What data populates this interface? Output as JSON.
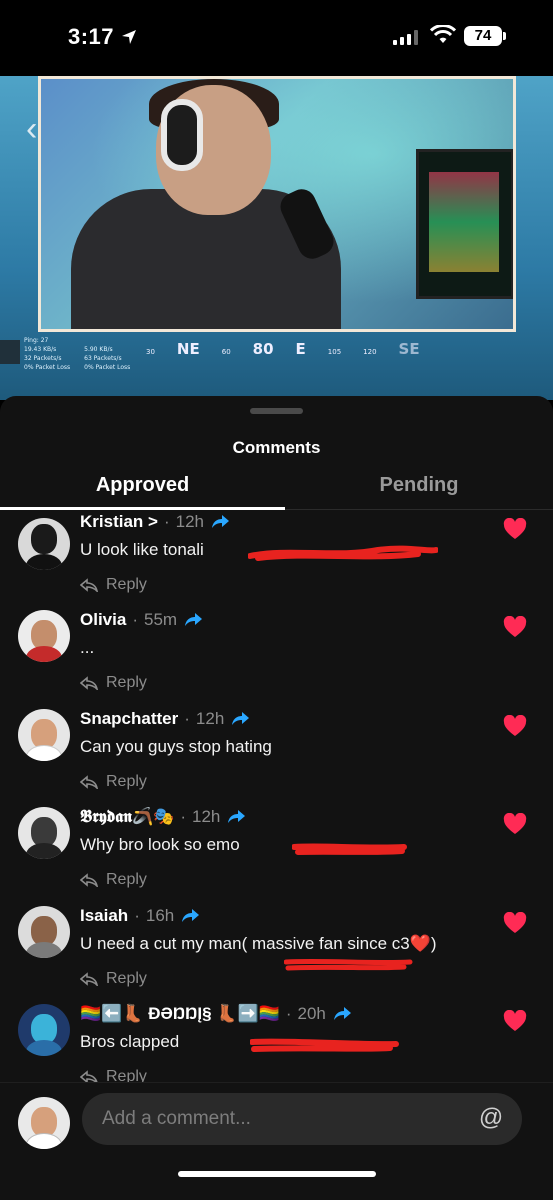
{
  "status_bar": {
    "time": "3:17",
    "battery": "74"
  },
  "video": {
    "hud_stats": [
      "Ping: 27",
      "19.43 KB/s",
      "32 Packets/s",
      "0% Packet Loss",
      "5.90 KB/s",
      "63 Packets/s",
      "0% Packet Loss"
    ],
    "compass": [
      "30",
      "NE",
      "60",
      "80",
      "E",
      "105",
      "120",
      "SE"
    ]
  },
  "sheet": {
    "title": "Comments",
    "tabs": [
      {
        "label": "Approved",
        "active": true
      },
      {
        "label": "Pending",
        "active": false
      }
    ]
  },
  "comments": [
    {
      "name": "Kristian >",
      "time": "12h",
      "text": "U look like tonali",
      "reply": "Reply",
      "liked": true
    },
    {
      "name": "Olivia",
      "time": "55m",
      "text": "...",
      "reply": "Reply",
      "liked": true
    },
    {
      "name": "Snapchatter",
      "time": "12h",
      "text": "Can you guys stop hating",
      "reply": "Reply",
      "liked": true
    },
    {
      "name": "𝕭𝖗𝖞𝖉𝖆𝖓🪃🎭",
      "time": "12h",
      "text": "Why bro look so emo",
      "reply": "Reply",
      "liked": true
    },
    {
      "name": "Isaiah",
      "time": "16h",
      "text": "U need a cut my man( massive fan since c3❤️)",
      "reply": "Reply",
      "liked": true
    },
    {
      "name": "🏳️‍🌈⬅️👢 ÐƏŊŊĮ§ 👢➡️🏳️‍🌈",
      "time": "20h",
      "text": "Bros clapped",
      "reply": "Reply",
      "liked": true
    }
  ],
  "composer": {
    "placeholder": "Add a comment..."
  },
  "colors": {
    "heart": "#ff2b55",
    "share": "#2aa7ff",
    "sheet_bg": "#121212",
    "scribble": "#e8231f"
  }
}
